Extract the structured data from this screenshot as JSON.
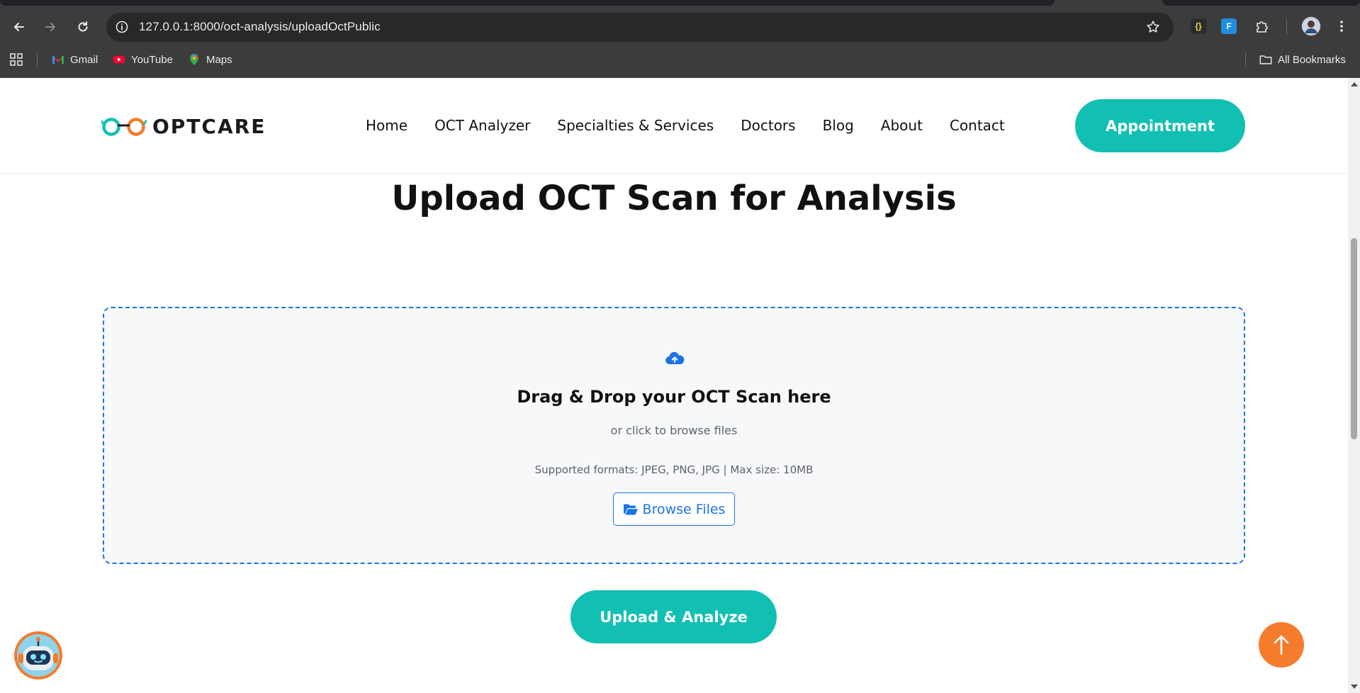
{
  "browser": {
    "url": "127.0.0.1:8000/oct-analysis/uploadOctPublic",
    "bookmarks": [
      {
        "label": "Gmail",
        "icon": "gmail-icon"
      },
      {
        "label": "YouTube",
        "icon": "youtube-icon"
      },
      {
        "label": "Maps",
        "icon": "maps-icon"
      }
    ],
    "all_bookmarks_label": "All Bookmarks"
  },
  "header": {
    "brand": "OPTCARE",
    "nav": [
      "Home",
      "OCT Analyzer",
      "Specialties & Services",
      "Doctors",
      "Blog",
      "About",
      "Contact"
    ],
    "cta": "Appointment"
  },
  "main": {
    "title": "Upload OCT Scan for Analysis",
    "dropzone": {
      "title": "Drag & Drop your OCT Scan here",
      "subtitle": "or click to browse files",
      "formats": "Supported formats: JPEG, PNG, JPG | Max size: 10MB",
      "browse_label": "Browse Files"
    },
    "submit_label": "Upload & Analyze"
  },
  "colors": {
    "accent_teal": "#12bfb3",
    "accent_blue": "#1a73e8",
    "accent_orange": "#f47c2c"
  }
}
